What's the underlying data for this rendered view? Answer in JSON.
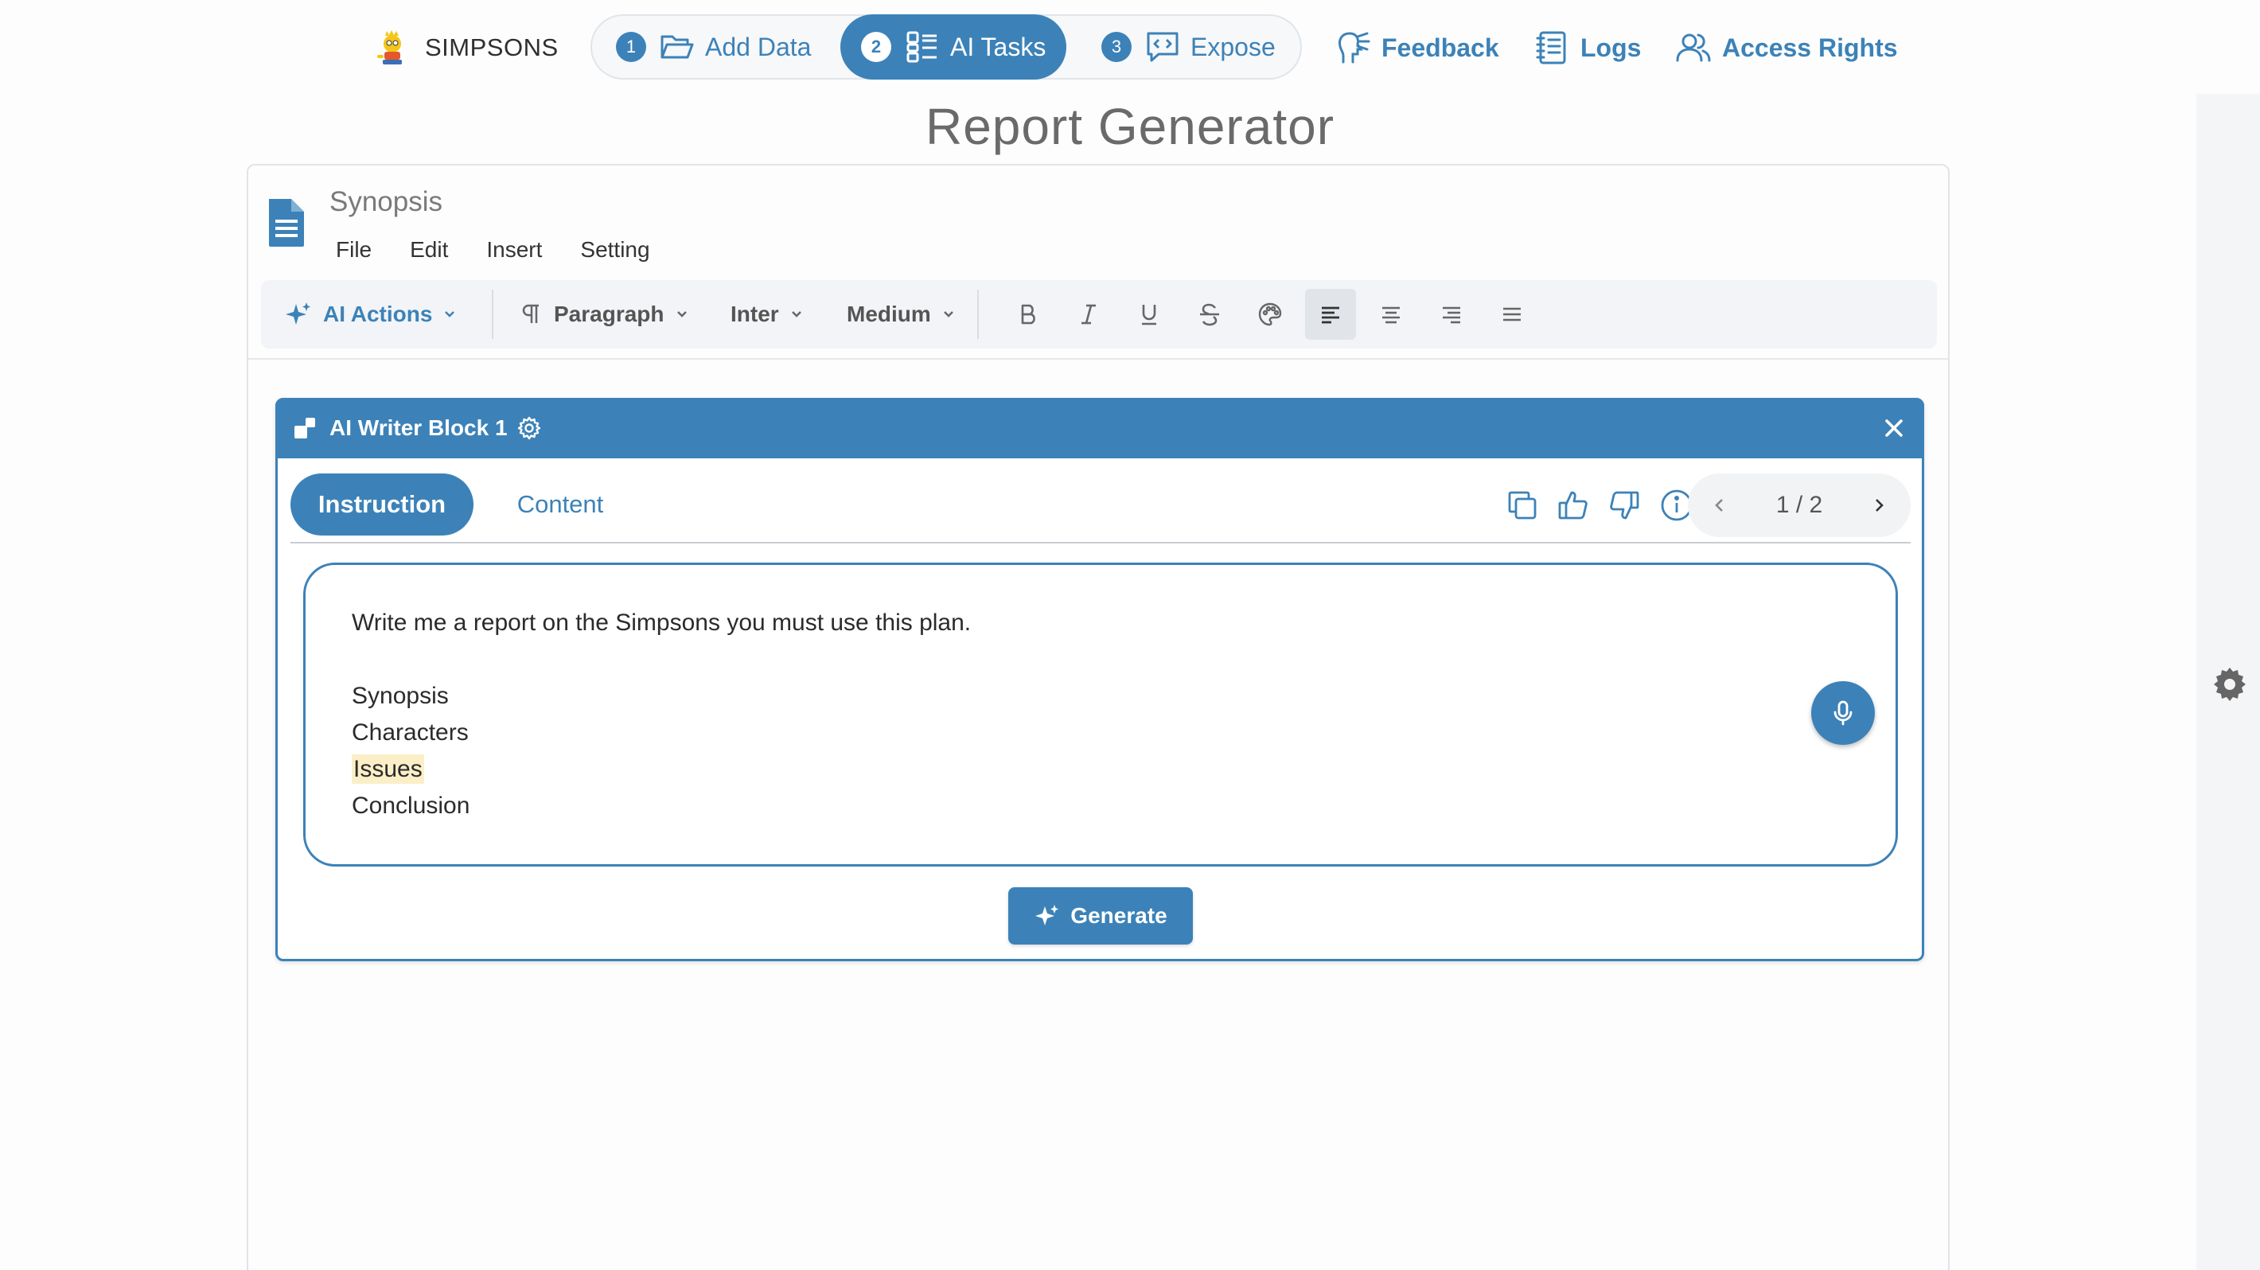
{
  "app": {
    "brand_name": "SIMPSONS",
    "accent_color": "#3c82b8"
  },
  "steps": [
    {
      "number": "1",
      "label": "Add Data",
      "icon": "folder-open-icon",
      "active": false
    },
    {
      "number": "2",
      "label": "AI Tasks",
      "icon": "tasks-grid-icon",
      "active": true
    },
    {
      "number": "3",
      "label": "Expose",
      "icon": "chat-code-icon",
      "active": false
    }
  ],
  "nav": {
    "feedback": "Feedback",
    "logs": "Logs",
    "access_rights": "Access Rights"
  },
  "page_title": "Report Generator",
  "document": {
    "title": "Synopsis",
    "menu": [
      "File",
      "Edit",
      "Insert",
      "Setting"
    ]
  },
  "toolbar": {
    "ai_actions": "AI Actions",
    "paragraph": "Paragraph",
    "font": "Inter",
    "weight": "Medium",
    "active_alignment": "align-left"
  },
  "block": {
    "title": "AI Writer Block 1",
    "tabs": {
      "instruction": "Instruction",
      "content": "Content"
    },
    "active_tab": "Instruction",
    "pager": "1 / 2",
    "instruction_lines": [
      "Write me a report on the Simpsons you must use this plan.",
      "",
      "Synopsis",
      "Characters",
      "Issues",
      "Conclusion"
    ],
    "highlighted_line": "Issues",
    "generate_label": "Generate"
  }
}
